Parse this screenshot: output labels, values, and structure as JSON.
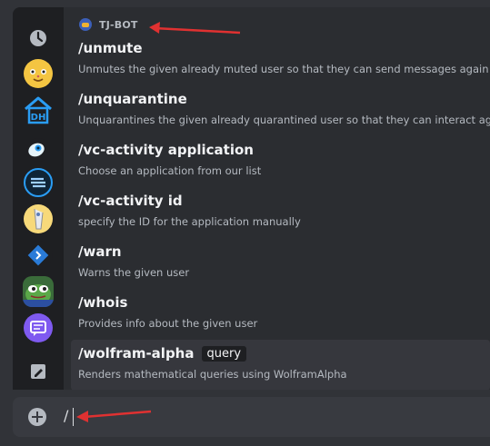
{
  "sidebar": {
    "items": [
      {
        "name": "recent-clock-icon"
      },
      {
        "name": "server-cat-icon"
      },
      {
        "name": "server-dh-house-icon"
      },
      {
        "name": "server-eyeball-icon"
      },
      {
        "name": "server-s-logo-icon"
      },
      {
        "name": "server-yellow-creature-icon"
      },
      {
        "name": "server-diamond-code-icon"
      },
      {
        "name": "server-frog-icon"
      },
      {
        "name": "server-chat-bubble-icon"
      },
      {
        "name": "server-pencil-icon"
      }
    ]
  },
  "bot": {
    "name": "TJ-BOT"
  },
  "commands": [
    {
      "name": "/unmute",
      "desc": "Unmutes the given already muted user so that they can send messages again"
    },
    {
      "name": "/unquarantine",
      "desc": "Unquarantines the given already quarantined user so that they can interact again"
    },
    {
      "name": "/vc-activity application",
      "desc": "Choose an application from our list"
    },
    {
      "name": "/vc-activity id",
      "desc": "specify the ID for the application manually"
    },
    {
      "name": "/warn",
      "desc": "Warns the given user"
    },
    {
      "name": "/whois",
      "desc": "Provides info about the given user"
    },
    {
      "name": "/wolfram-alpha",
      "param": "query",
      "desc": "Renders mathematical queries using WolframAlpha",
      "selected": true
    }
  ],
  "composer": {
    "value": "/"
  },
  "colors": {
    "accent": "#5865f2",
    "annotation_arrow": "#e03131"
  }
}
